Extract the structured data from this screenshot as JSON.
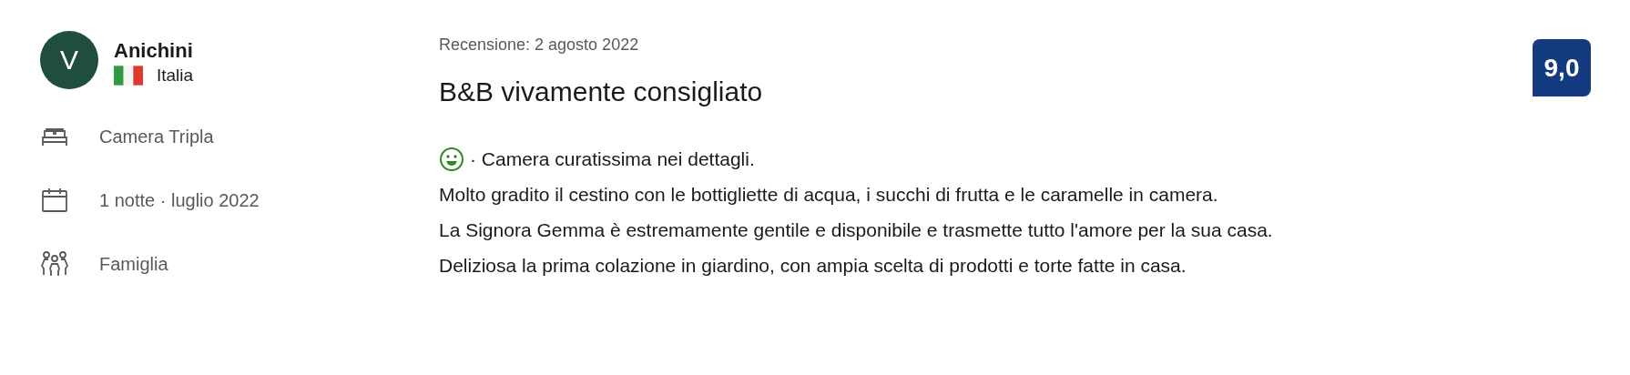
{
  "reviewer": {
    "initial": "V",
    "name": "Anichini",
    "country": "Italia"
  },
  "stay": [
    {
      "kind": "room",
      "text": "Camera Tripla"
    },
    {
      "kind": "date",
      "text": "1 notte ·  luglio 2022"
    },
    {
      "kind": "group",
      "text": "Famiglia"
    }
  ],
  "review": {
    "date": "Recensione: 2 agosto 2022",
    "title": "B&B vivamente consigliato",
    "score": "9,0",
    "comment": {
      "kind": "liked",
      "lead": "· Camera curatissima nei dettagli.",
      "paragraphs": [
        "Molto gradito il cestino con le bottigliette di acqua, i succhi di frutta e le caramelle in camera.",
        "La Signora Gemma è estremamente gentile e disponibile e trasmette tutto l'amore per la sua casa.",
        "Deliziosa la prima colazione in giardino, con ampia scelta di prodotti e torte fatte in casa."
      ]
    }
  }
}
